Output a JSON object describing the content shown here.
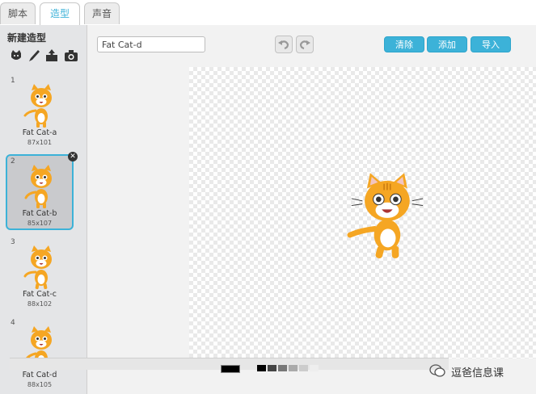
{
  "tabs": [
    {
      "label": "脚本"
    },
    {
      "label": "造型"
    },
    {
      "label": "声音"
    }
  ],
  "left_panel": {
    "title": "新建造型",
    "costumes": [
      {
        "number": "1",
        "name": "Fat Cat-a",
        "size": "87x101"
      },
      {
        "number": "2",
        "name": "Fat Cat-b",
        "size": "85x107",
        "selected": true
      },
      {
        "number": "3",
        "name": "Fat Cat-c",
        "size": "88x102"
      },
      {
        "number": "4",
        "name": "Fat Cat-d",
        "size": "88x105"
      }
    ]
  },
  "editor": {
    "costume_name_value": "Fat Cat-d",
    "buttons": {
      "clear": "清除",
      "add": "添加",
      "import": "导入"
    }
  },
  "watermark": {
    "text": "逗爸信息课"
  },
  "colors": {
    "accent": "#3cb2d8",
    "cat_orange": "#f5a623",
    "panel_bg": "#e4e5e7"
  }
}
